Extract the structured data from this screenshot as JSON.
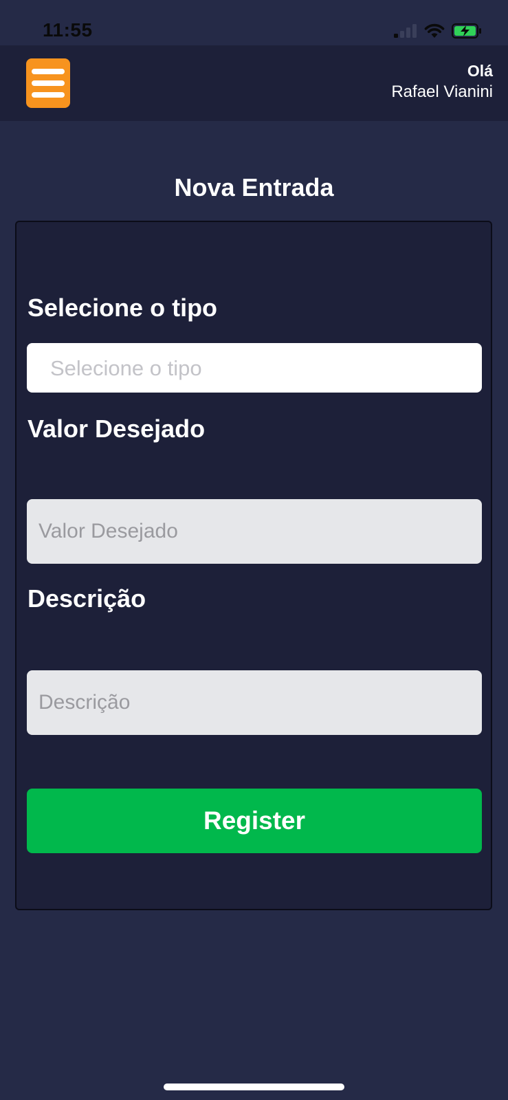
{
  "status_bar": {
    "time": "11:55",
    "icons": [
      "cellular-signal-icon",
      "wifi-icon",
      "battery-charging-icon"
    ],
    "battery_color": "#30d158"
  },
  "header": {
    "menu_icon": "hamburger-menu-icon",
    "menu_color": "#f7931e",
    "greeting": "Olá",
    "user_name": "Rafael Vianini"
  },
  "page": {
    "title": "Nova Entrada"
  },
  "form": {
    "type_label": "Selecione o tipo",
    "type_placeholder": "Selecione o tipo",
    "value_label": "Valor Desejado",
    "value_placeholder": "Valor Desejado",
    "description_label": "Descrição",
    "description_placeholder": "Descrição",
    "submit_label": "Register",
    "submit_color": "#01b84c"
  }
}
